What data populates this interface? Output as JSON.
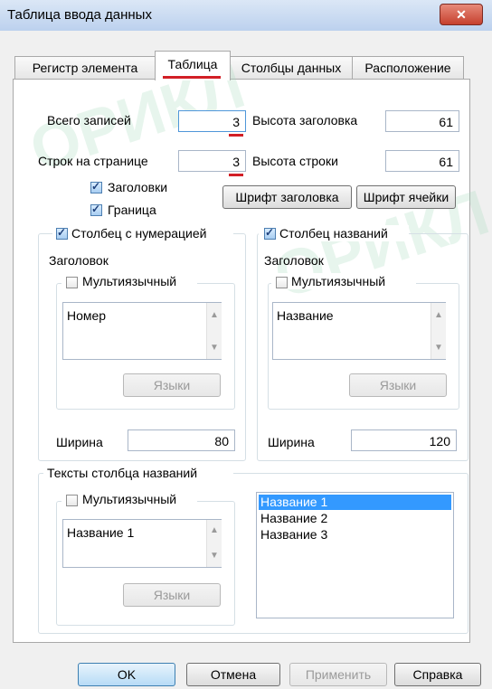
{
  "window": {
    "title": "Таблица ввода данных",
    "close_glyph": "✕"
  },
  "tabs": [
    {
      "label": "Регистр элемента"
    },
    {
      "label": "Таблица"
    },
    {
      "label": "Столбцы данных"
    },
    {
      "label": "Расположение"
    }
  ],
  "settings": {
    "total_records_label": "Всего записей",
    "total_records_value": "3",
    "rows_per_page_label": "Строк на странице",
    "rows_per_page_value": "3",
    "header_height_label": "Высота заголовка",
    "header_height_value": "61",
    "row_height_label": "Высота строки",
    "row_height_value": "61",
    "headers_check_label": "Заголовки",
    "border_check_label": "Граница",
    "header_font_button": "Шрифт заголовка",
    "cell_font_button": "Шрифт ячейки"
  },
  "numbering_column": {
    "check_label": "Столбец с нумерацией",
    "header_label": "Заголовок",
    "multilang_label": "Мультиязычный",
    "text_value": "Номер",
    "languages_button": "Языки",
    "width_label": "Ширина",
    "width_value": "80"
  },
  "names_column": {
    "check_label": "Столбец названий",
    "header_label": "Заголовок",
    "multilang_label": "Мультиязычный",
    "text_value": "Название",
    "languages_button": "Языки",
    "width_label": "Ширина",
    "width_value": "120"
  },
  "name_texts": {
    "group_label": "Тексты столбца названий",
    "multilang_label": "Мультиязычный",
    "text_value": "Название 1",
    "languages_button": "Языки",
    "items": [
      "Название 1",
      "Название 2",
      "Название 3"
    ]
  },
  "footer": {
    "ok": "OK",
    "cancel": "Отмена",
    "apply": "Применить",
    "help": "Справка"
  },
  "watermark": {
    "text1": "ОРИКЛ",
    "text2": "ОРИКЛ"
  },
  "colors": {
    "accent_red": "#d21f26",
    "selection": "#3399ff"
  }
}
